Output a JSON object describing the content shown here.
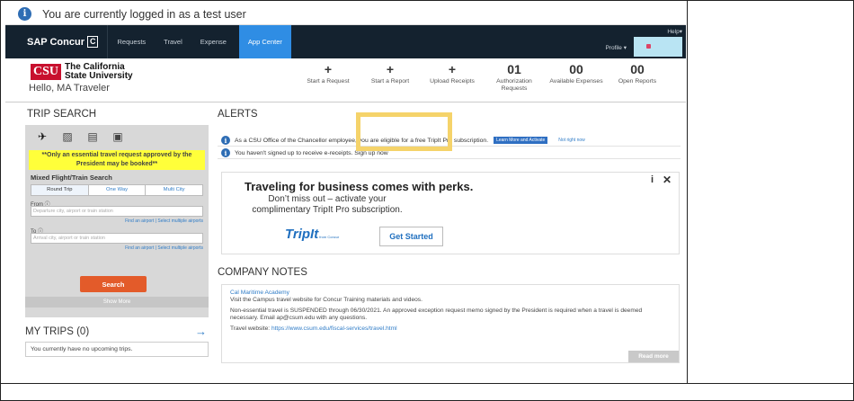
{
  "banner": {
    "text": "You are currently logged in as a test user"
  },
  "nav": {
    "brand": "SAP Concur",
    "brand_box": "C",
    "items": [
      "Requests",
      "Travel",
      "Expense",
      "App Center"
    ],
    "active": "App Center",
    "help": "Help▾",
    "profile": "Profile ▾"
  },
  "header": {
    "logo_mark": "CSU",
    "logo_line1": "The California",
    "logo_line2": "State University",
    "greeting": "Hello, MA Traveler",
    "quick": [
      {
        "top": "+",
        "label": "Start a Request"
      },
      {
        "top": "+",
        "label": "Start a Report"
      },
      {
        "top": "+",
        "label": "Upload Receipts"
      },
      {
        "top": "01",
        "label": "Authorization Requests"
      },
      {
        "top": "00",
        "label": "Available Expenses"
      },
      {
        "top": "00",
        "label": "Open Reports"
      }
    ]
  },
  "trip_search": {
    "title": "TRIP SEARCH",
    "modes": [
      "flight-train",
      "car",
      "hotel",
      "train"
    ],
    "notice": "**Only an essential travel request approved by the President may be booked**",
    "section": "Mixed Flight/Train Search",
    "tabs": [
      "Round Trip",
      "One Way",
      "Multi City"
    ],
    "from_label": "From",
    "from_placeholder": "Departure city, airport or train station",
    "to_label": "To",
    "to_placeholder": "Arrival city, airport or train station",
    "find_links": "Find an airport  |  Select multiple airports",
    "search_button": "Search",
    "show_more": "Show More"
  },
  "my_trips": {
    "title": "MY TRIPS (0)",
    "empty": "You currently have no upcoming trips."
  },
  "alerts": {
    "title": "ALERTS",
    "items": [
      {
        "text": "As a CSU Office of the Chancellor employee, you are eligible for a free TripIt Pro subscription.",
        "cta": "Learn More and Activate",
        "dismiss": "Not right now"
      },
      {
        "text": "You haven't signed up to receive e-receipts. Sign up now"
      }
    ]
  },
  "promo": {
    "title": "Traveling for business comes with perks.",
    "subtitle": "Don’t miss out – activate your complimentary TripIt Pro subscription.",
    "logo": "TripIt",
    "logo_sub": "from Concur",
    "button": "Get Started"
  },
  "notes": {
    "title": "COMPANY NOTES",
    "school": "Cal Maritime Academy",
    "line1": "Visit the Campus travel website for Concur Training materials and videos.",
    "line2": "Non-essential travel is SUSPENDED through 06/30/2021. An approved exception request memo signed by the President is required when a travel is deemed necessary.  Email ap@csum.edu with any questions.",
    "website_label": "Travel website: ",
    "website": "https://www.csum.edu/fiscal-services/travel.html",
    "read_more": "Read more"
  }
}
